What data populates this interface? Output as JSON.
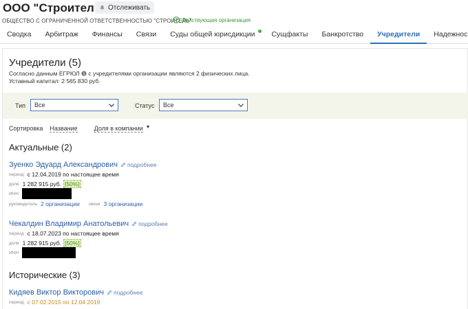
{
  "header": {
    "title": "ООО \"Строитель\"",
    "follow_label": "Отслеживать",
    "full_name": "ОБЩЕСТВО С ОГРАНИЧЕННОЙ ОТВЕТСТВЕННОСТЬЮ \"СТРОИТЕЛЬ\"",
    "status": "Действующая организация"
  },
  "tabs": [
    {
      "label": "Сводка"
    },
    {
      "label": "Арбитраж"
    },
    {
      "label": "Финансы"
    },
    {
      "label": "Связи"
    },
    {
      "label": "Суды общей юрисдикции"
    },
    {
      "label": "Сущфакты"
    },
    {
      "label": "Банкротство"
    },
    {
      "label": "Учредители"
    },
    {
      "label": "Надежнос"
    }
  ],
  "section": {
    "title": "Учредители (5)",
    "desc_before": "Согласно данным ЕГРЮЛ",
    "desc_after": "с учредителями организации являются 2 физических лица.",
    "capital": "Уставный капитал: 2 565 830 руб."
  },
  "filters": {
    "type_label": "Тип",
    "type_value": "Все",
    "status_label": "Статус",
    "status_value": "Все"
  },
  "sort": {
    "label": "Сортировка",
    "by_name": "Название",
    "by_share": "Доля в компании",
    "arrow": "▼"
  },
  "groups": {
    "actual": "Актуальные (2)",
    "historical": "Исторические (3)"
  },
  "labels": {
    "more": "подробнее",
    "period": "период",
    "share": "доля",
    "inn": "ИНН",
    "head": "руководитель",
    "links": "связи"
  },
  "persons": [
    {
      "name": "Зуенко Эдуард Александрович",
      "period": "с 12.04.2019 по настоящее время",
      "share": "1 282 915 руб.",
      "pct": "[50%]",
      "head_orgs": "2 организации",
      "link_orgs": "3 организации"
    },
    {
      "name": "Чекалдин Владимир Анатольевич",
      "period": "с 18.07.2023 по настоящее время",
      "share": "1 282 915 руб.",
      "pct": "[50%]"
    },
    {
      "name": "Кидяев Виктор Викторович",
      "period": "с 07.02.2015 по 12.04.2019"
    }
  ]
}
